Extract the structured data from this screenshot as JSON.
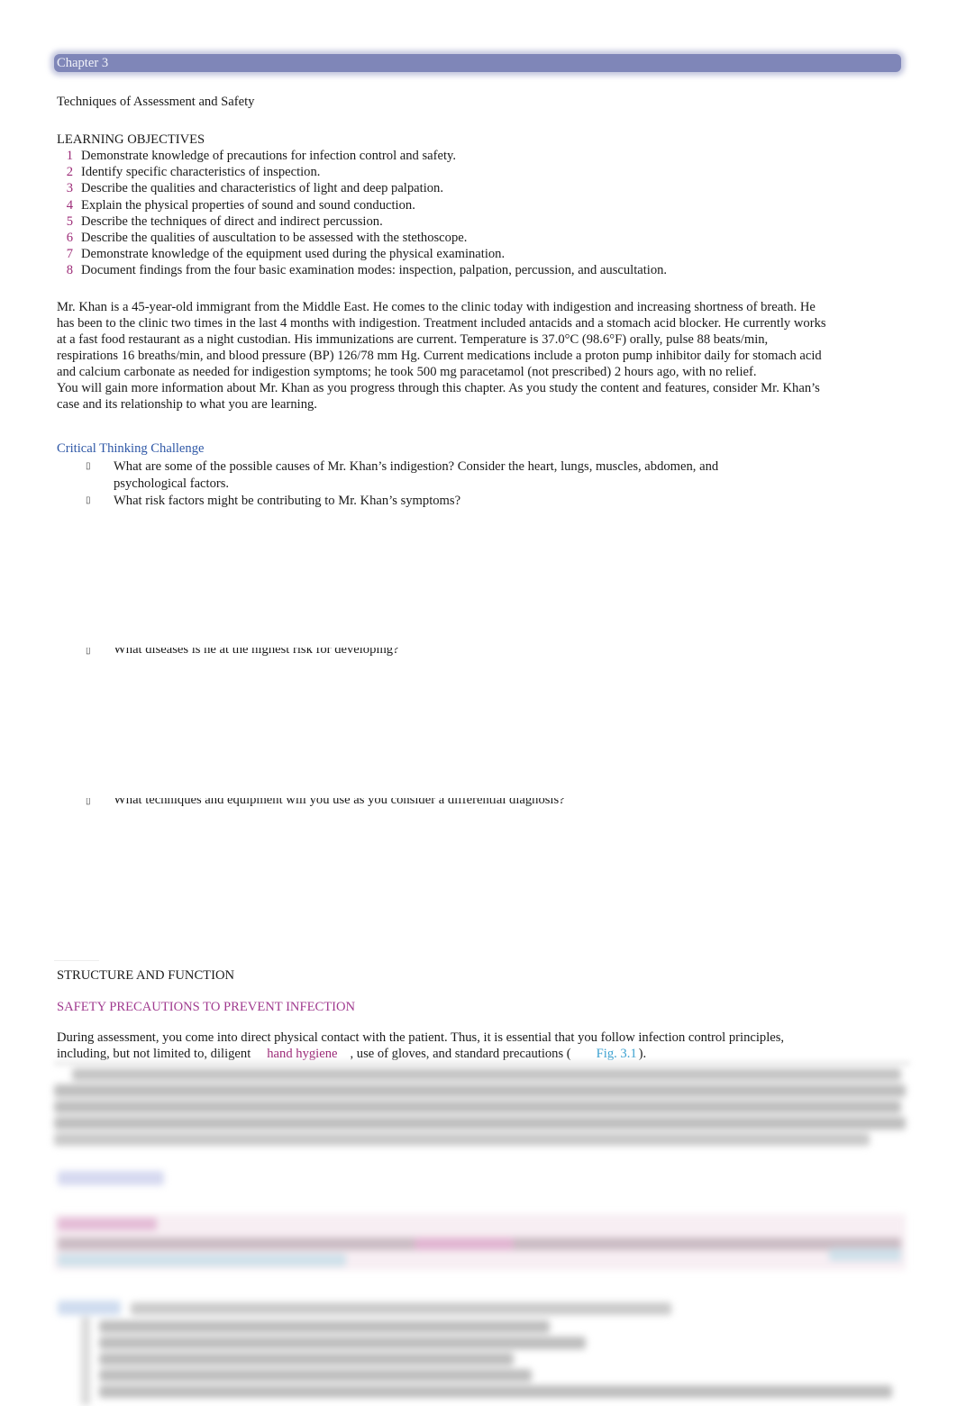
{
  "header": {
    "chapter_label": "Chapter 3",
    "chapter_bar_color": "#7f86b8"
  },
  "title": "Techniques of Assessment and Safety",
  "learning_objectives": {
    "heading": "LEARNING OBJECTIVES",
    "number_color": "#9c2a77",
    "items": [
      {
        "num": "1",
        "text": "Demonstrate knowledge of precautions for infection control and safety."
      },
      {
        "num": "2",
        "text": "Identify specific characteristics of inspection."
      },
      {
        "num": "3",
        "text": "Describe the qualities and characteristics of light and deep palpation."
      },
      {
        "num": "4",
        "text": "Explain the physical properties of sound and sound conduction."
      },
      {
        "num": "5",
        "text": "Describe the techniques of direct and indirect percussion."
      },
      {
        "num": "6",
        "text": "Describe the qualities of auscultation to be assessed with the stethoscope."
      },
      {
        "num": "7",
        "text": "Demonstrate knowledge of the equipment used during the physical examination."
      },
      {
        "num": "8",
        "text": "Document findings from the four basic examination modes: inspection, palpation, percussion, and auscultation."
      }
    ]
  },
  "case_study": {
    "paragraph_1": "Mr. Khan is a 45-year-old immigrant from the Middle East. He comes to the clinic today with indigestion and increasing shortness of breath. He has been to the clinic two times in the last 4 months with indigestion. Treatment included antacids and a stomach acid blocker. He currently works at a fast food restaurant as a night custodian. His immunizations are current. Temperature is 37.0°C (98.6°F) orally, pulse 88 beats/min, respirations 16 breaths/min, and blood pressure (BP) 126/78 mm Hg. Current medications include a proton pump inhibitor daily for stomach acid and calcium carbonate as needed for indigestion symptoms; he took 500 mg paracetamol (not prescribed) 2 hours ago, with no relief.",
    "paragraph_2": "You will gain more information about Mr. Khan as you progress through this chapter. As you study the content and features, consider Mr. Khan’s case and its relationship to what you are learning."
  },
  "critical_thinking": {
    "heading": "Critical Thinking Challenge",
    "heading_color": "#2e57a6",
    "bullet_glyph": "▯",
    "items": [
      {
        "text": "What are some of the possible causes of Mr. Khan’s indigestion? Consider the heart, lungs, muscles, abdomen, and psychological factors."
      },
      {
        "text": "What risk factors might be contributing to Mr. Khan’s symptoms?"
      },
      {
        "text": "What diseases is he at the highest risk for developing?"
      },
      {
        "text": "What techniques and equipment will you use as you consider a differential diagnosis?"
      }
    ]
  },
  "structure_function": {
    "heading": "STRUCTURE AND FUNCTION",
    "subheading": "SAFETY PRECAUTIONS TO PREVENT INFECTION",
    "subheading_color": "#a03a8f",
    "paragraph": {
      "before_link": "During assessment, you come into direct physical contact with the patient. Thus, it is essential that you follow infection control principles, including, but not limited to, diligent",
      "link_hand_hygiene": "hand hygiene",
      "middle": ", use of gloves, and standard precautions (",
      "link_fig": "Fig. 3.1",
      "after": ")."
    },
    "link_colors": {
      "hand_hygiene": "#9c2a77",
      "figure_ref": "#3aa0d0"
    }
  }
}
